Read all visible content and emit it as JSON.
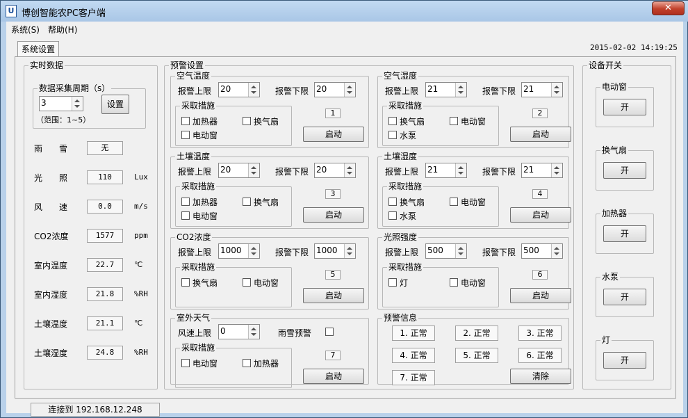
{
  "window": {
    "title": "博创智能农PC客户端",
    "icon_text": "U",
    "close_glyph": "✕"
  },
  "menu": [
    "系统(S)",
    "帮助(H)"
  ],
  "tab": "系统设置",
  "datetime": "2015-02-02 14:19:25",
  "realtime": {
    "title": "实时数据",
    "period_group": "数据采集周期（s）",
    "period_value": "3",
    "set_button": "设置",
    "range_note": "（范围：1~5）",
    "rows": [
      {
        "label": "雨　　雪",
        "value": "无",
        "unit": ""
      },
      {
        "label": "光　　照",
        "value": "110",
        "unit": "Lux"
      },
      {
        "label": "风　　速",
        "value": "0.0",
        "unit": "m/s"
      },
      {
        "label": "CO2浓度",
        "value": "1577",
        "unit": "ppm"
      },
      {
        "label": "室内温度",
        "value": "22.7",
        "unit": "℃"
      },
      {
        "label": "室内湿度",
        "value": "21.8",
        "unit": "%RH"
      },
      {
        "label": "土壤温度",
        "value": "21.1",
        "unit": "℃"
      },
      {
        "label": "土壤湿度",
        "value": "24.8",
        "unit": "%RH"
      }
    ]
  },
  "alarm_settings": {
    "title": "预警设置",
    "upper_label": "报警上限",
    "lower_label": "报警下限",
    "measures_label": "采取措施",
    "start_label": "启动",
    "panels": [
      {
        "title": "空气温度",
        "upper": "20",
        "lower": "20",
        "num": "1",
        "opts": [
          "加热器",
          "换气扇",
          "电动窗"
        ]
      },
      {
        "title": "空气湿度",
        "upper": "21",
        "lower": "21",
        "num": "2",
        "opts": [
          "换气扇",
          "电动窗",
          "水泵"
        ]
      },
      {
        "title": "土壤温度",
        "upper": "20",
        "lower": "20",
        "num": "3",
        "opts": [
          "加热器",
          "换气扇",
          "电动窗"
        ]
      },
      {
        "title": "土壤湿度",
        "upper": "21",
        "lower": "21",
        "num": "4",
        "opts": [
          "换气扇",
          "电动窗",
          "水泵"
        ]
      },
      {
        "title": "CO2浓度",
        "upper": "1000",
        "lower": "1000",
        "num": "5",
        "opts": [
          "换气扇",
          "电动窗"
        ]
      },
      {
        "title": "光照强度",
        "upper": "500",
        "lower": "500",
        "num": "6",
        "opts": [
          "灯",
          "电动窗"
        ]
      }
    ],
    "outdoor": {
      "title": "室外天气",
      "wind_label": "风速上限",
      "wind_value": "0",
      "snow_label": "雨雪预警",
      "num": "7",
      "opts": [
        "电动窗",
        "加热器"
      ]
    }
  },
  "alarm_info": {
    "title": "预警信息",
    "items": [
      "1. 正常",
      "2. 正常",
      "3. 正常",
      "4. 正常",
      "5. 正常",
      "6. 正常",
      "7. 正常"
    ],
    "clear_label": "清除"
  },
  "device_switch": {
    "title": "设备开关",
    "devices": [
      {
        "name": "电动窗",
        "button": "开"
      },
      {
        "name": "换气扇",
        "button": "开"
      },
      {
        "name": "加热器",
        "button": "开"
      },
      {
        "name": "水泵",
        "button": "开"
      },
      {
        "name": "灯",
        "button": "开"
      }
    ]
  },
  "status": "连接到 192.168.12.248"
}
